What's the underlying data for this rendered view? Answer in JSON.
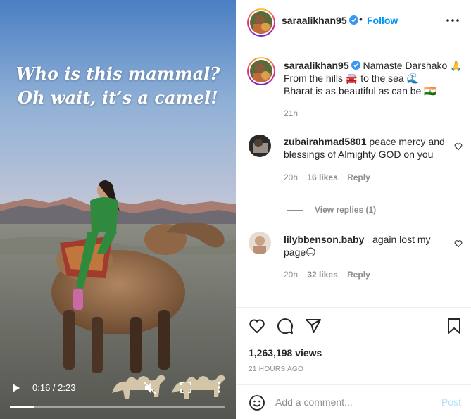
{
  "video": {
    "caption_line1": "Who is this mammal?",
    "caption_line2": "Oh wait, it’s a camel!",
    "time": "0:16 / 2:23",
    "progress": 0.112
  },
  "header": {
    "username": "saraalikhan95",
    "separator": "•",
    "follow_label": "Follow"
  },
  "post": {
    "username": "saraalikhan95",
    "caption_line1": "Namaste Darshako 🙏",
    "caption_line2": "From the hills 🚘 to the sea 🌊",
    "caption_line3": "Bharat is as beautiful as can be 🇮🇳",
    "time": "21h"
  },
  "comments": [
    {
      "username": "zubairahmad5801",
      "text": "peace mercy and blessings of Almighty GOD on you",
      "time": "20h",
      "likes": "16 likes",
      "reply_label": "Reply"
    },
    {
      "username": "lilybbenson.baby_",
      "text": "again lost my page😑",
      "time": "20h",
      "likes": "32 likes",
      "reply_label": "Reply"
    }
  ],
  "view_replies": "View replies (1)",
  "stats": {
    "views": "1,263,198 views",
    "time_ago": "21 HOURS AGO"
  },
  "add_comment": {
    "placeholder": "Add a comment...",
    "post_label": "Post"
  },
  "colors": {
    "accent": "#0095f6",
    "post_disabled": "#b2dffc",
    "muted": "#8e8e8e"
  },
  "icons": [
    "verified-icon",
    "more-options-icon",
    "heart-icon",
    "comment-icon",
    "share-icon",
    "bookmark-icon",
    "emoji-icon",
    "play-icon",
    "mute-icon",
    "fullscreen-icon"
  ]
}
